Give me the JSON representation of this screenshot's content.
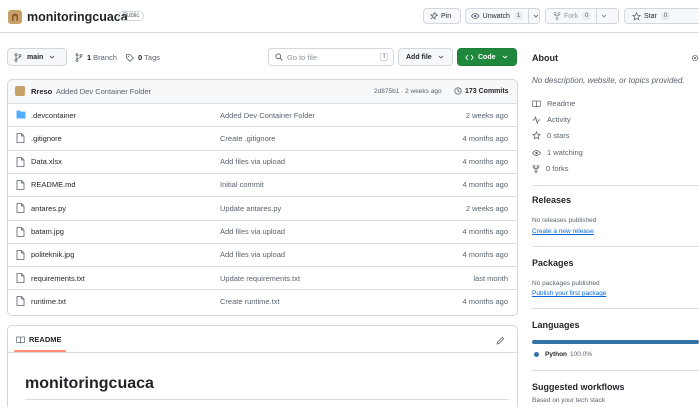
{
  "header": {
    "repo_name": "monitoringcuaca",
    "visibility": "Public",
    "pin_label": "Pin",
    "unwatch_label": "Unwatch",
    "unwatch_count": "1",
    "fork_label": "Fork",
    "fork_count": "0",
    "star_label": "Star",
    "star_count": "0"
  },
  "toolbar": {
    "branch": "main",
    "branches_count": "1",
    "branches_label": "Branch",
    "tags_count": "0",
    "tags_label": "Tags",
    "search_placeholder": "Go to file",
    "search_shortcut": "t",
    "add_file_label": "Add file",
    "code_label": "Code"
  },
  "commit": {
    "author": "Rreso",
    "message": "Added Dev Container Folder",
    "hash_time": "2d875b1 · 2 weeks ago",
    "commits_label": "173 Commits"
  },
  "files": [
    {
      "name": ".devcontainer",
      "type": "folder",
      "message": "Added Dev Container Folder",
      "time": "2 weeks ago"
    },
    {
      "name": ".gitignore",
      "type": "file",
      "message": "Create .gitignore",
      "time": "4 months ago"
    },
    {
      "name": "Data.xlsx",
      "type": "file",
      "message": "Add files via upload",
      "time": "4 months ago"
    },
    {
      "name": "README.md",
      "type": "file",
      "message": "Initial commit",
      "time": "4 months ago"
    },
    {
      "name": "antares.py",
      "type": "file",
      "message": "Update antares.py",
      "time": "2 weeks ago"
    },
    {
      "name": "batam.jpg",
      "type": "file",
      "message": "Add files via upload",
      "time": "4 months ago"
    },
    {
      "name": "politeknik.jpg",
      "type": "file",
      "message": "Add files via upload",
      "time": "4 months ago"
    },
    {
      "name": "requirements.txt",
      "type": "file",
      "message": "Update requirements.txt",
      "time": "last month"
    },
    {
      "name": "runtime.txt",
      "type": "file",
      "message": "Create runtime.txt",
      "time": "4 months ago"
    }
  ],
  "readme": {
    "tab_label": "README",
    "heading": "monitoringcuaca"
  },
  "sidebar": {
    "about_title": "About",
    "description": "No description, website, or topics provided.",
    "items": [
      {
        "label": "Readme"
      },
      {
        "label": "Activity"
      },
      {
        "label": "0 stars"
      },
      {
        "label": "1 watching"
      },
      {
        "label": "0 forks"
      }
    ],
    "releases_title": "Releases",
    "releases_text": "No releases published",
    "releases_link": "Create a new release",
    "packages_title": "Packages",
    "packages_text": "No packages published",
    "packages_link": "Publish your first package",
    "languages_title": "Languages",
    "language_name": "Python",
    "language_percent": "100.0%",
    "language_fraction": 1.0,
    "language_color": "#3572A5",
    "workflows_title": "Suggested workflows",
    "workflows_text": "Based on your tech stack"
  },
  "colors": {
    "accent_green": "#1f883d",
    "link_blue": "#0969da",
    "folder_blue": "#54aeff"
  }
}
